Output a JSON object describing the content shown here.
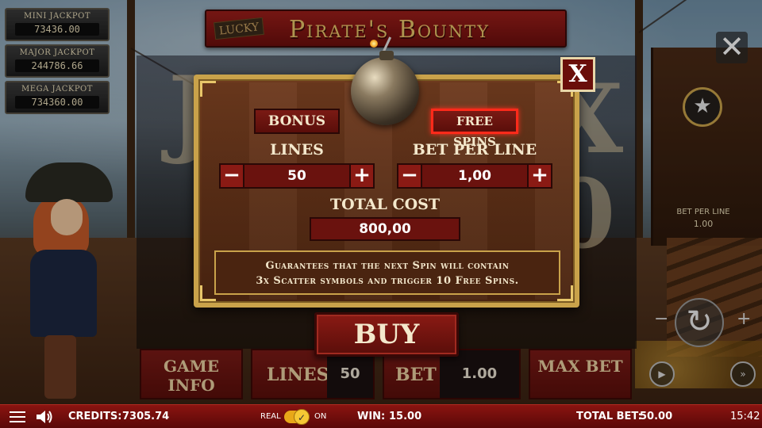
{
  "jackpots": [
    {
      "label": "MINI JACKPOT",
      "value": "73436.00"
    },
    {
      "label": "MAJOR JACKPOT",
      "value": "244786.66"
    },
    {
      "label": "MEGA JACKPOT",
      "value": "734360.00"
    }
  ],
  "title": {
    "lucky": "LUCKY",
    "main": "Pirate's Bounty"
  },
  "side": {
    "bet_per_line_label": "BET PER LINE",
    "bet_per_line_value": "1.00"
  },
  "panel": {
    "game_info": "GAME INFO",
    "lines_label": "LINES",
    "lines_value": "50",
    "bet_label": "BET",
    "bet_value": "1.00",
    "max_bet": "MAX BET"
  },
  "status": {
    "credits_label": "CREDITS:",
    "credits_value": "7305.74",
    "real_label": "REAL",
    "on_label": "ON",
    "win_label": "WIN:",
    "win_value": "15.00",
    "total_bet_label": "TOTAL BET:",
    "total_bet_value": "50.00",
    "clock": "15:42"
  },
  "modal": {
    "close_label": "X",
    "tabs": {
      "bonus": "BONUS",
      "free_spins": "FREE SPINS",
      "selected": "free_spins"
    },
    "lines_label": "LINES",
    "lines_value": "50",
    "bet_per_line_label": "BET PER LINE",
    "bet_per_line_value": "1,00",
    "total_cost_label": "TOTAL  COST",
    "total_cost_value": "800,00",
    "description_line1": "Guarantees that the next Spin will contain",
    "description_line2": "3x Scatter symbols and trigger 10 Free Spins.",
    "buy_label": "BUY",
    "minus_symbol": "−",
    "plus_symbol": "+"
  },
  "colors": {
    "accent_gold": "#c9a24a",
    "button_red": "#7a1a14",
    "selected_glow": "#ff2a1a"
  },
  "icons": {
    "close": "close-icon",
    "star": "star-icon",
    "spin": "spin-arrow-icon",
    "sound": "speaker-icon",
    "menu": "hamburger-icon"
  }
}
